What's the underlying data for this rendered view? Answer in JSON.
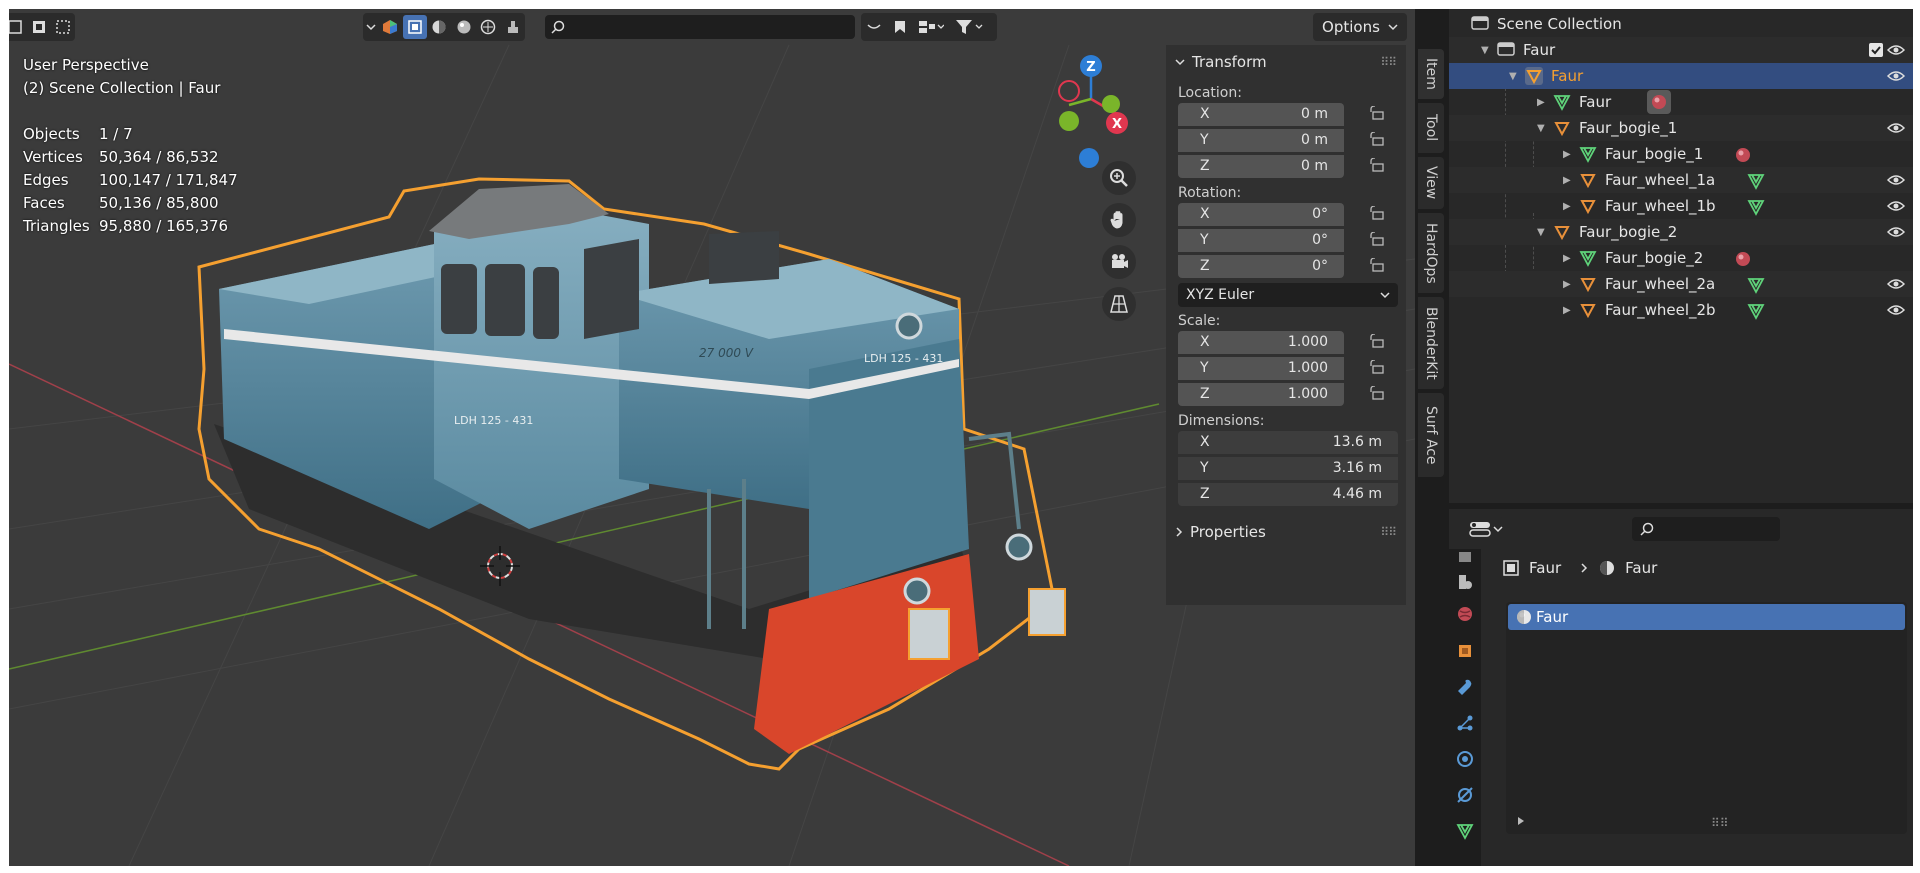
{
  "viewport": {
    "view_name": "User Perspective",
    "collection_line": "(2) Scene Collection | Faur",
    "stats": [
      {
        "label": "Objects",
        "value": "1 / 7"
      },
      {
        "label": "Vertices",
        "value": "50,364 / 86,532"
      },
      {
        "label": "Edges",
        "value": "100,147 / 171,847"
      },
      {
        "label": "Faces",
        "value": "50,136 / 85,800"
      },
      {
        "label": "Triangles",
        "value": "95,880 / 165,376"
      }
    ],
    "options_label": "Options",
    "gizmo": {
      "z": "Z",
      "x": "X"
    },
    "model_texts": [
      "LDH 125 - 431",
      "LDH 125 - 431",
      "27 000 V"
    ]
  },
  "npanel": {
    "transform_label": "Transform",
    "location_label": "Location:",
    "location": [
      {
        "axis": "X",
        "value": "0 m"
      },
      {
        "axis": "Y",
        "value": "0 m"
      },
      {
        "axis": "Z",
        "value": "0 m"
      }
    ],
    "rotation_label": "Rotation:",
    "rotation": [
      {
        "axis": "X",
        "value": "0°"
      },
      {
        "axis": "Y",
        "value": "0°"
      },
      {
        "axis": "Z",
        "value": "0°"
      }
    ],
    "rotation_mode": "XYZ Euler",
    "scale_label": "Scale:",
    "scale": [
      {
        "axis": "X",
        "value": "1.000"
      },
      {
        "axis": "Y",
        "value": "1.000"
      },
      {
        "axis": "Z",
        "value": "1.000"
      }
    ],
    "dimensions_label": "Dimensions:",
    "dimensions": [
      {
        "axis": "X",
        "value": "13.6 m"
      },
      {
        "axis": "Y",
        "value": "3.16 m"
      },
      {
        "axis": "Z",
        "value": "4.46 m"
      }
    ],
    "properties_label": "Properties"
  },
  "tabs": [
    "Item",
    "Tool",
    "View",
    "HardOps",
    "BlenderKit",
    "Surf Ace"
  ],
  "outliner": {
    "root": "Scene Collection",
    "rows": [
      {
        "name": "Faur",
        "kind": "collection"
      },
      {
        "name": "Faur",
        "kind": "empty",
        "selected": true
      },
      {
        "name": "Faur",
        "kind": "mesh"
      },
      {
        "name": "Faur_bogie_1",
        "kind": "empty"
      },
      {
        "name": "Faur_bogie_1",
        "kind": "mesh"
      },
      {
        "name": "Faur_wheel_1a",
        "kind": "empty"
      },
      {
        "name": "Faur_wheel_1b",
        "kind": "empty"
      },
      {
        "name": "Faur_bogie_2",
        "kind": "empty"
      },
      {
        "name": "Faur_bogie_2",
        "kind": "mesh"
      },
      {
        "name": "Faur_wheel_2a",
        "kind": "empty"
      },
      {
        "name": "Faur_wheel_2b",
        "kind": "empty"
      }
    ]
  },
  "properties": {
    "breadcrumb_object": "Faur",
    "breadcrumb_material": "Faur",
    "material_slot": "Faur"
  },
  "colors": {
    "accent_blue": "#4772b3",
    "selection_orange": "#f5a030",
    "empty_orange": "#e8903a",
    "mesh_green": "#5fd37a",
    "axis_red": "#e0374f",
    "axis_green": "#7ab52a",
    "axis_blue": "#2d7ed6"
  }
}
